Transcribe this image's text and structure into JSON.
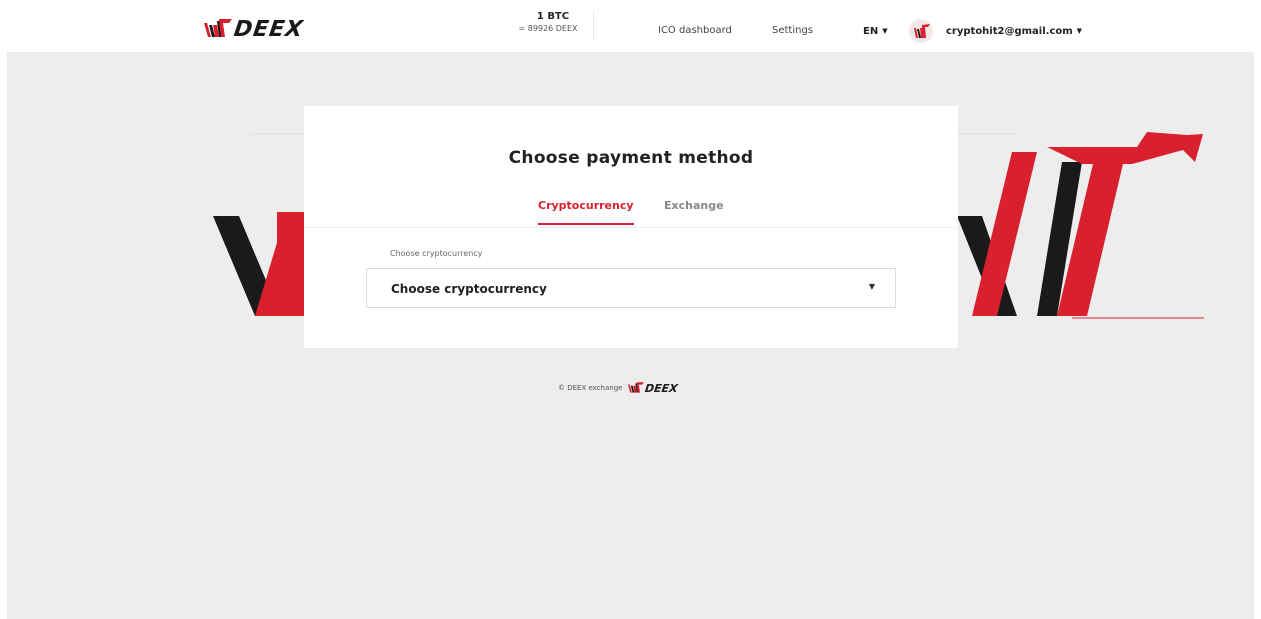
{
  "header": {
    "logo_text": "DEEX",
    "rate_top": "1 BTC",
    "rate_bottom": "= 89926 DEEX",
    "nav_ico": "ICO dashboard",
    "nav_settings": "Settings",
    "lang": "EN",
    "user_email": "cryptohit2@gmail.com"
  },
  "card": {
    "title": "Choose payment method",
    "tabs": [
      {
        "label": "Cryptocurrency",
        "active": true
      },
      {
        "label": "Exchange",
        "active": false
      }
    ],
    "field_label": "Choose cryptocurrency",
    "select_value": "Choose cryptocurrency"
  },
  "footer": {
    "text": "© DEEX exchange",
    "logo_text": "DEEX"
  },
  "colors": {
    "brand_red": "#d9202f",
    "brand_black": "#1a1a1a",
    "page_bg": "#ededed"
  }
}
